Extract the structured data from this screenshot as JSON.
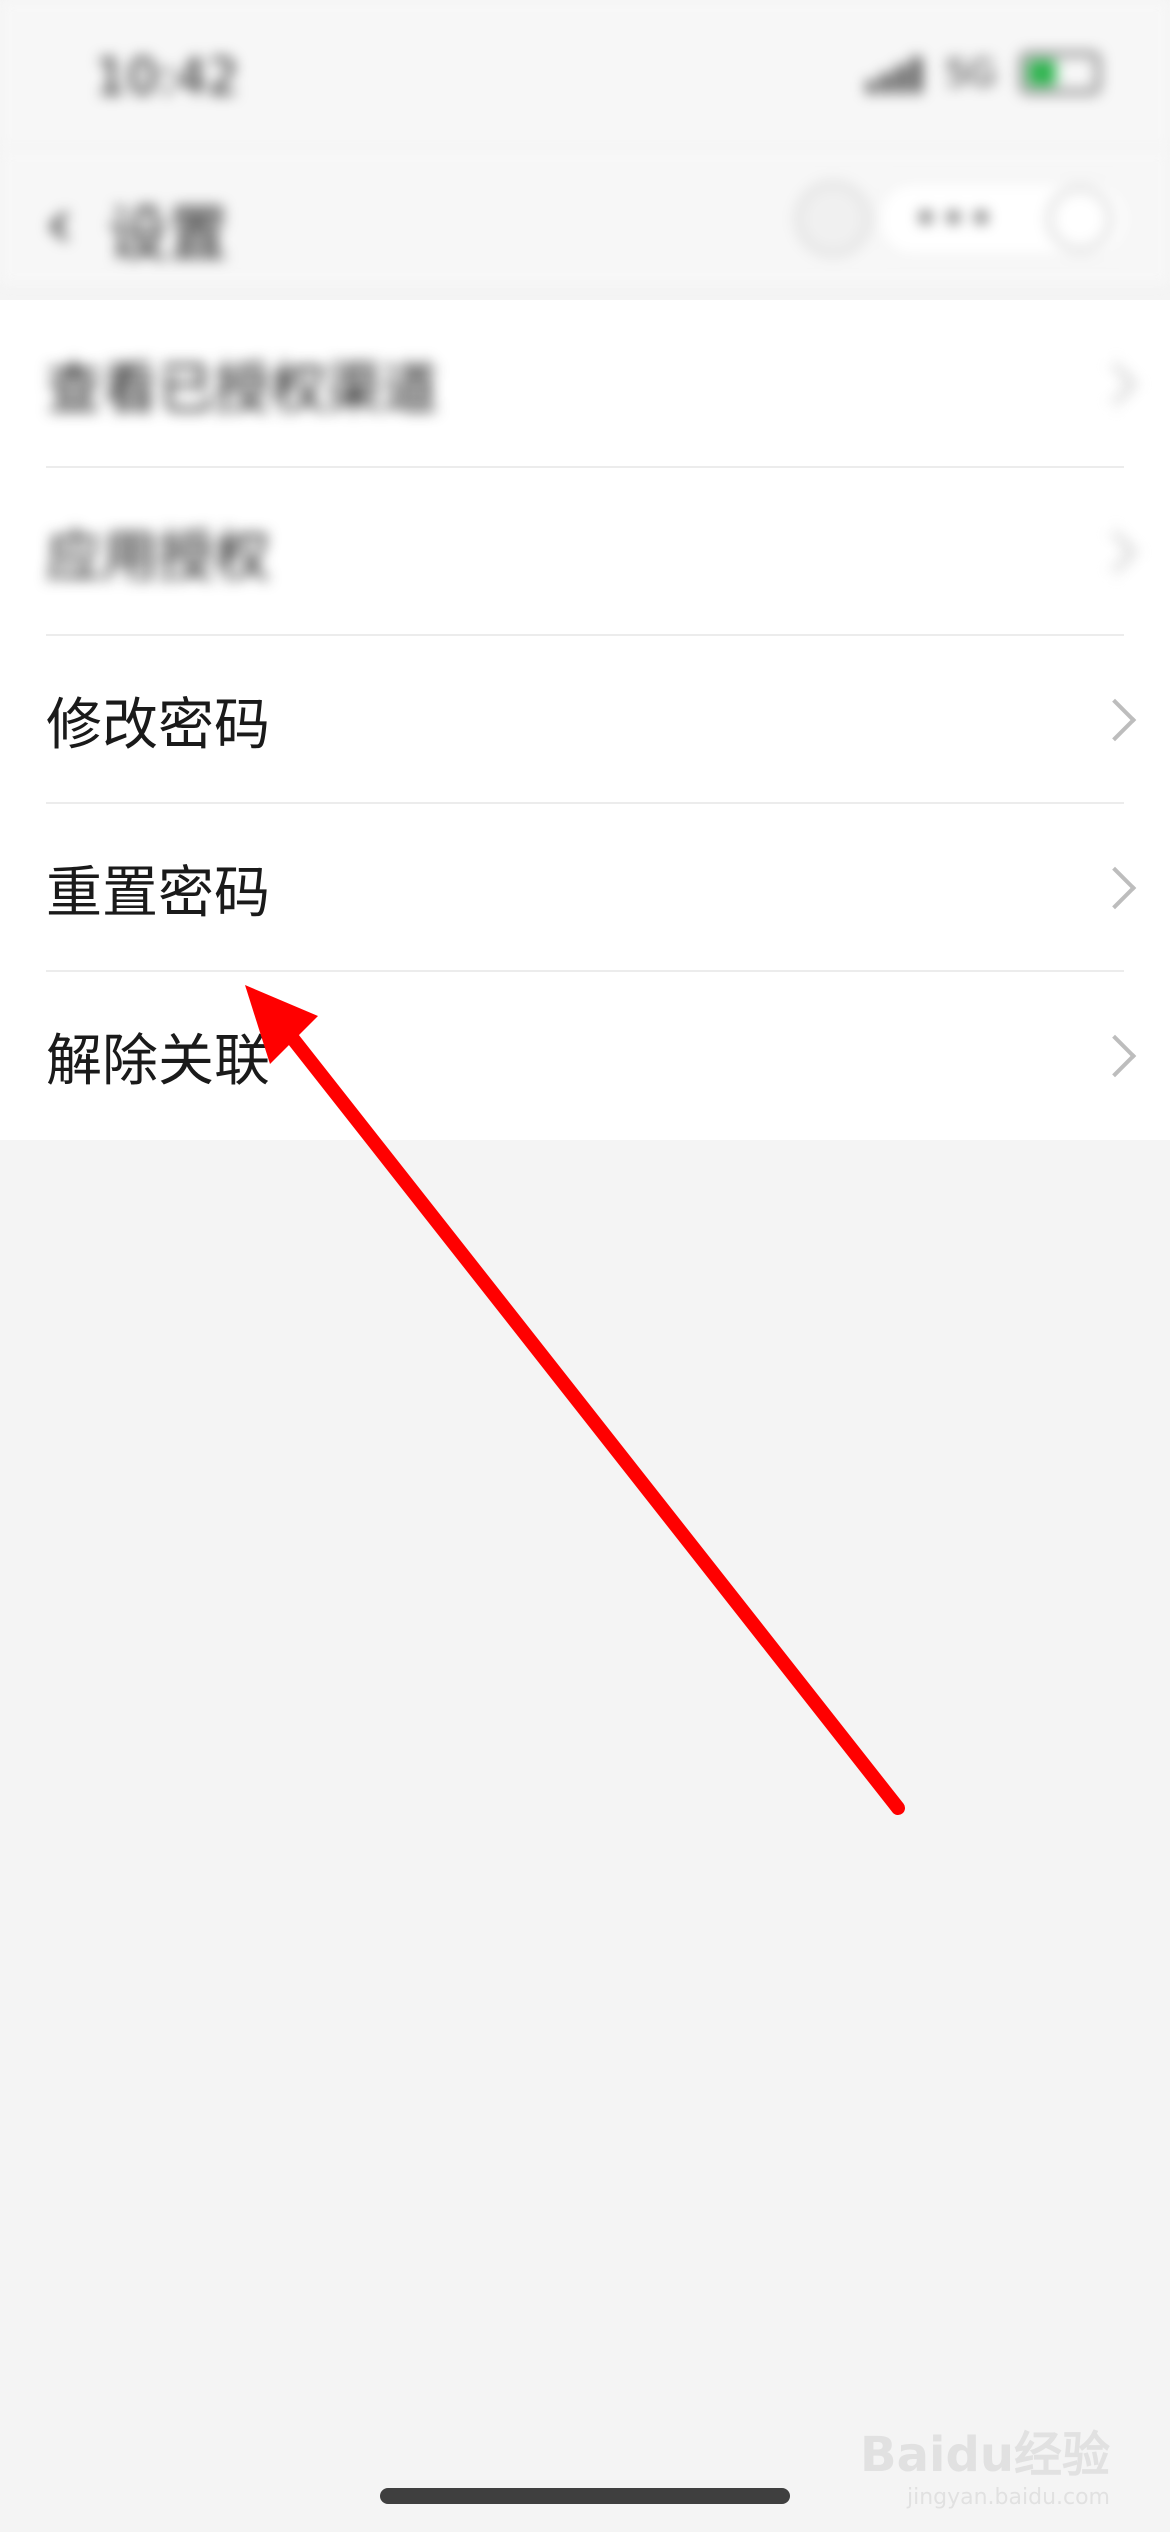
{
  "status_bar": {
    "time": "10:42",
    "network": "5G",
    "battery_color": "#2bb24c"
  },
  "nav": {
    "back_icon": "chevron-left-icon",
    "title": "设置",
    "more_label": "•••"
  },
  "menu": {
    "items": [
      {
        "label": "查看已授权渠道",
        "blurred": true
      },
      {
        "label": "应用授权",
        "blurred": true
      },
      {
        "label": "修改密码",
        "blurred": false
      },
      {
        "label": "重置密码",
        "blurred": false
      },
      {
        "label": "解除关联",
        "blurred": false
      }
    ]
  },
  "annotation": {
    "color": "#ff0000",
    "target": "重置密码"
  },
  "watermark": {
    "brand": "Baidu经验",
    "url": "jingyan.baidu.com"
  }
}
